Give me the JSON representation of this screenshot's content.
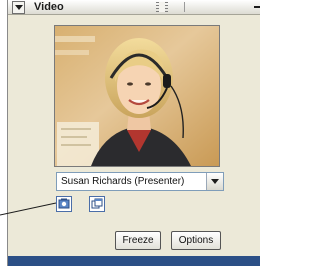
{
  "panel": {
    "title": "Video",
    "icons": {
      "collapse": "collapse-triangle-icon",
      "grip": "drag-grip-icon",
      "menu": "panel-menu-icon"
    }
  },
  "video": {
    "content": "presenter-video-feed"
  },
  "presenter_select": {
    "selected": "Susan Richards (Presenter)"
  },
  "icon_buttons": {
    "first": "video-settings-icon",
    "second": "popout-window-icon"
  },
  "buttons": {
    "freeze": "Freeze",
    "options": "Options"
  },
  "colors": {
    "panel_bg": "#ece9d8",
    "status_bar": "#2b4f86",
    "accent": "#4b6ea8"
  }
}
